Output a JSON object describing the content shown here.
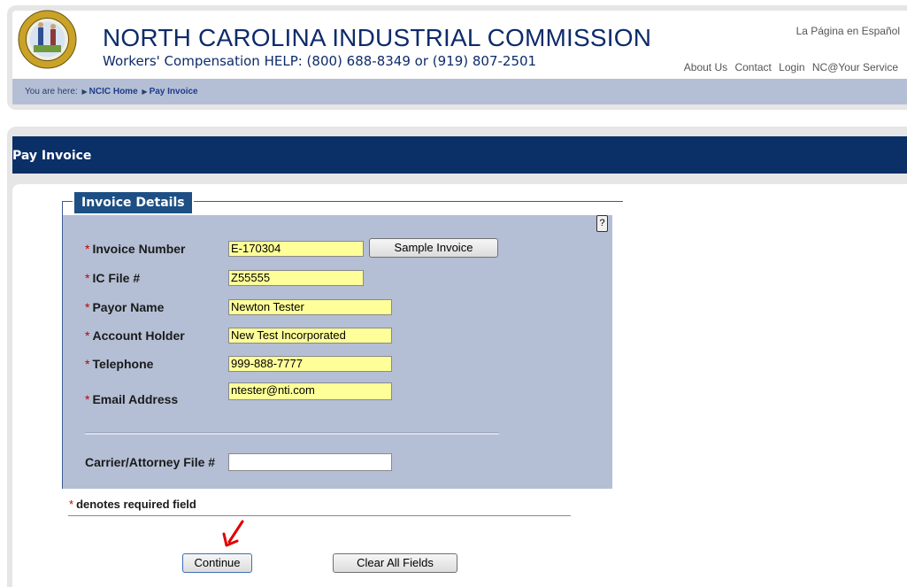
{
  "header": {
    "title": "NORTH CAROLINA INDUSTRIAL COMMISSION",
    "subtitle": "Workers' Compensation HELP: (800) 688-8349 or (919) 807-2501",
    "language_link": "La Página en Español",
    "nav": [
      "About Us",
      "Contact",
      "Login",
      "NC@Your Service"
    ]
  },
  "breadcrumb": {
    "prefix": "You are here:",
    "items": [
      "NCIC Home",
      "Pay Invoice"
    ]
  },
  "page": {
    "title": "Pay Invoice"
  },
  "form": {
    "legend": "Invoice Details",
    "help_label": "?",
    "required_mark": "*",
    "fields": [
      {
        "label": "Invoice Number",
        "value": "E-170304",
        "required": true
      },
      {
        "label": "IC File #",
        "value": "Z55555",
        "required": true
      },
      {
        "label": "Payor Name",
        "value": "Newton Tester",
        "required": true
      },
      {
        "label": "Account Holder",
        "value": "New Test Incorporated",
        "required": true
      },
      {
        "label": "Telephone",
        "value": "999-888-7777",
        "required": true
      },
      {
        "label": "Email Address",
        "value": "ntester@nti.com",
        "required": true
      }
    ],
    "optional_field": {
      "label": "Carrier/Attorney File #",
      "value": ""
    },
    "sample_button": "Sample Invoice",
    "required_note": "denotes required field",
    "continue_button": "Continue",
    "clear_button": "Clear All Fields"
  },
  "colors": {
    "brand_navy": "#0b2f67",
    "field_highlight": "#ffff99",
    "panel_fill": "#b4bfd5",
    "required_red": "#c00000",
    "annotation_arrow": "#e00000"
  }
}
